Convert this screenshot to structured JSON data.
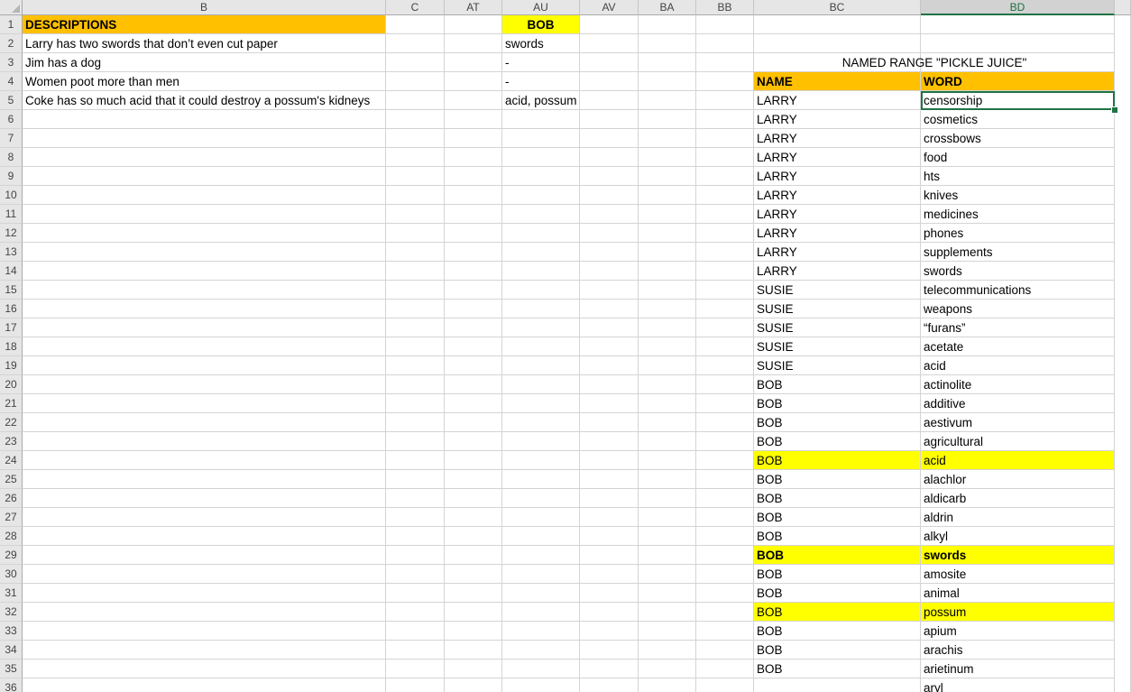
{
  "columns": [
    "B",
    "C",
    "AT",
    "AU",
    "AV",
    "BA",
    "BB",
    "BC",
    "BD"
  ],
  "selected_column": "BD",
  "row_numbers": [
    "1",
    "2",
    "3",
    "4",
    "5",
    "6",
    "7",
    "8",
    "9",
    "10",
    "11",
    "12",
    "13",
    "14",
    "15",
    "16",
    "17",
    "18",
    "19",
    "20",
    "21",
    "22",
    "23",
    "24",
    "25",
    "26",
    "27",
    "28",
    "29",
    "30",
    "31",
    "32",
    "33",
    "34",
    "35",
    "36"
  ],
  "descriptions": {
    "header": "DESCRIPTIONS",
    "items": [
      "Larry has two swords that don’t even cut paper",
      "Jim has a dog",
      "Women poot more than men",
      "Coke has so much acid that it could destroy a possum's kidneys"
    ]
  },
  "au_column": {
    "header": "BOB",
    "items": [
      "swords",
      "-",
      "-",
      "acid, possum"
    ]
  },
  "named_range_title": "NAMED RANGE \"PICKLE JUICE\"",
  "table": {
    "headers": {
      "name": "NAME",
      "word": "WORD"
    },
    "rows": [
      {
        "name": "LARRY",
        "word": "censorship"
      },
      {
        "name": "LARRY",
        "word": "cosmetics"
      },
      {
        "name": "LARRY",
        "word": "crossbows"
      },
      {
        "name": "LARRY",
        "word": "food"
      },
      {
        "name": "LARRY",
        "word": "hts"
      },
      {
        "name": "LARRY",
        "word": "knives"
      },
      {
        "name": "LARRY",
        "word": "medicines"
      },
      {
        "name": "LARRY",
        "word": "phones"
      },
      {
        "name": "LARRY",
        "word": "supplements"
      },
      {
        "name": "LARRY",
        "word": "swords"
      },
      {
        "name": "SUSIE",
        "word": "telecommunications"
      },
      {
        "name": "SUSIE",
        "word": "weapons"
      },
      {
        "name": "SUSIE",
        "word": "“furans”"
      },
      {
        "name": "SUSIE",
        "word": "acetate"
      },
      {
        "name": "SUSIE",
        "word": "acid"
      },
      {
        "name": "BOB",
        "word": "actinolite"
      },
      {
        "name": "BOB",
        "word": "additive"
      },
      {
        "name": "BOB",
        "word": "aestivum"
      },
      {
        "name": "BOB",
        "word": "agricultural"
      },
      {
        "name": "BOB",
        "word": "acid",
        "highlight": true
      },
      {
        "name": "BOB",
        "word": "alachlor"
      },
      {
        "name": "BOB",
        "word": "aldicarb"
      },
      {
        "name": "BOB",
        "word": "aldrin"
      },
      {
        "name": "BOB",
        "word": "alkyl"
      },
      {
        "name": "BOB",
        "word": "swords",
        "highlight": true,
        "bold": true
      },
      {
        "name": "BOB",
        "word": "amosite"
      },
      {
        "name": "BOB",
        "word": "animal"
      },
      {
        "name": "BOB",
        "word": "possum",
        "highlight": true
      },
      {
        "name": "BOB",
        "word": "apium"
      },
      {
        "name": "BOB",
        "word": "arachis"
      },
      {
        "name": "BOB",
        "word": "arietinum"
      },
      {
        "name": "",
        "word": "aryl"
      }
    ]
  },
  "colors": {
    "header_orange": "#ffc000",
    "highlight_yellow": "#ffff00",
    "selection_green": "#217346"
  }
}
